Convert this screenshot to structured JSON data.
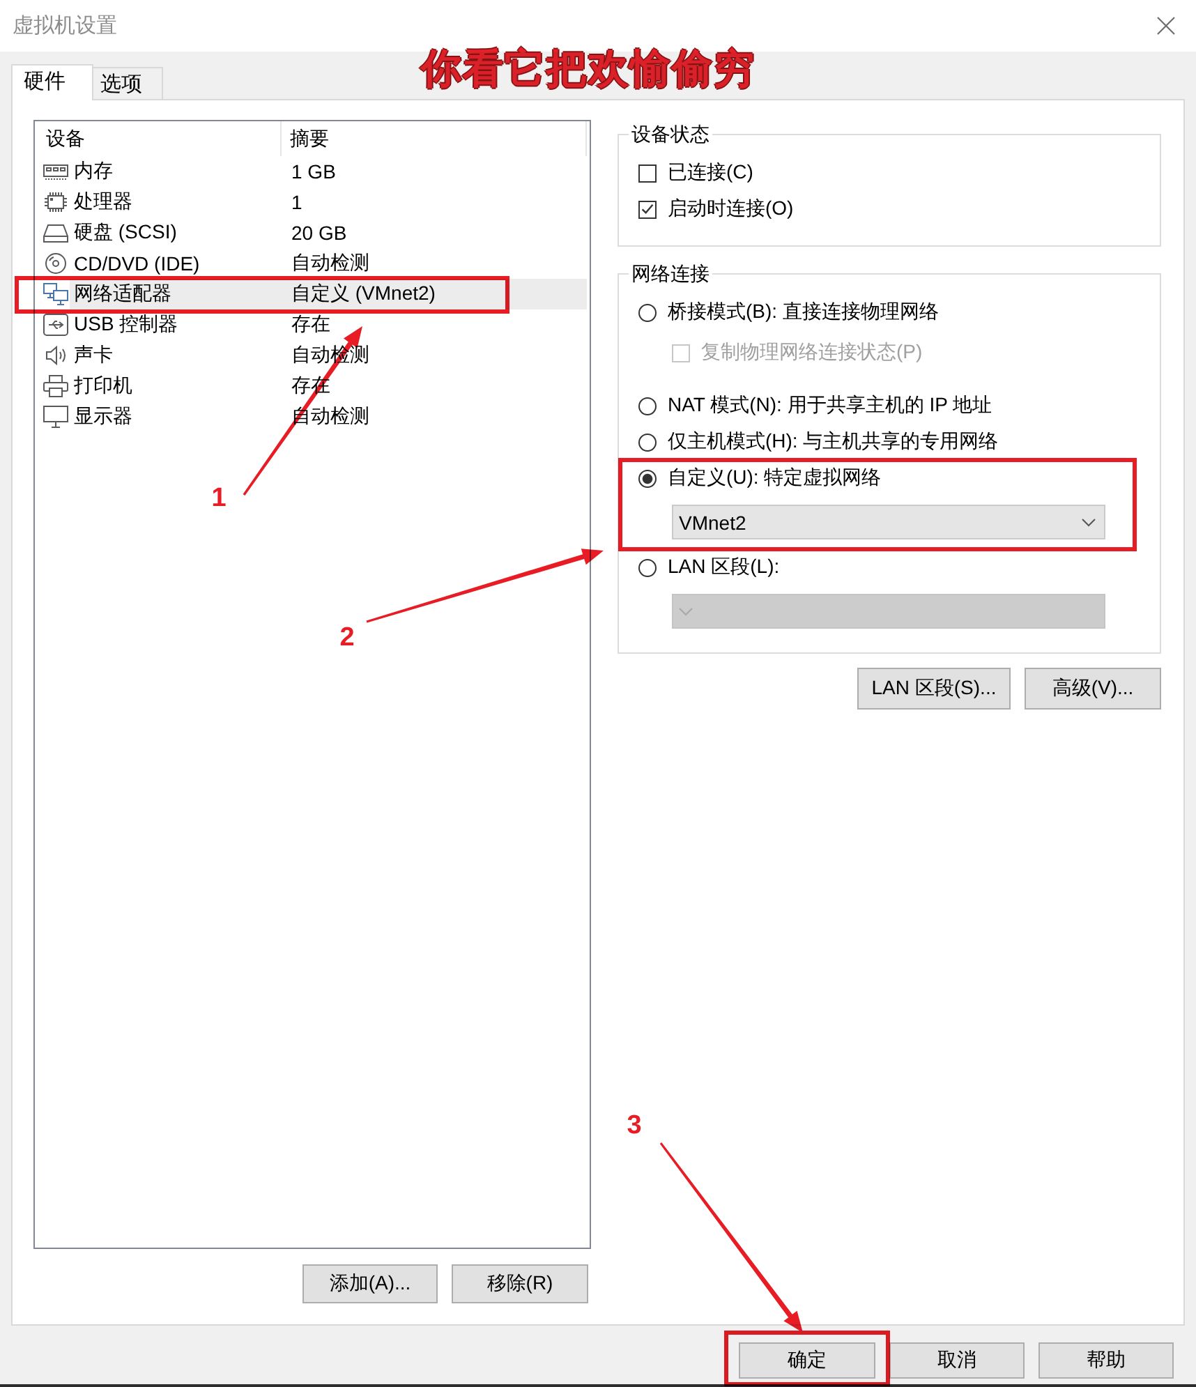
{
  "window": {
    "title": "虚拟机设置"
  },
  "tabs": [
    {
      "label": "硬件",
      "selected": true
    },
    {
      "label": "选项",
      "selected": false
    }
  ],
  "device_list": {
    "columns": [
      "设备",
      "摘要"
    ],
    "rows": [
      {
        "kind": "memory",
        "device": "内存",
        "summary": "1 GB",
        "selected": false
      },
      {
        "kind": "processor",
        "device": "处理器",
        "summary": "1",
        "selected": false
      },
      {
        "kind": "hard_disk",
        "device": "硬盘 (SCSI)",
        "summary": "20 GB",
        "selected": false
      },
      {
        "kind": "cd_dvd",
        "device": "CD/DVD (IDE)",
        "summary": "自动检测",
        "selected": false
      },
      {
        "kind": "network",
        "device": "网络适配器",
        "summary": "自定义 (VMnet2)",
        "selected": true
      },
      {
        "kind": "usb",
        "device": "USB 控制器",
        "summary": "存在",
        "selected": false
      },
      {
        "kind": "sound",
        "device": "声卡",
        "summary": "自动检测",
        "selected": false
      },
      {
        "kind": "printer",
        "device": "打印机",
        "summary": "存在",
        "selected": false
      },
      {
        "kind": "display",
        "device": "显示器",
        "summary": "自动检测",
        "selected": false
      }
    ]
  },
  "device_buttons": [
    "添加(A)...",
    "移除(R)"
  ],
  "device_status": {
    "title": "设备状态",
    "options": [
      {
        "kind": "checkbox",
        "label": "已连接(C)",
        "checked": false
      },
      {
        "kind": "checkbox",
        "label": "启动时连接(O)",
        "checked": true
      }
    ]
  },
  "network_connection": {
    "title": "网络连接",
    "options": [
      {
        "kind": "radio",
        "label": "桥接模式(B): 直接连接物理网络",
        "selected": false,
        "children": [
          {
            "kind": "checkbox",
            "label": "复制物理网络连接状态(P)",
            "checked": false,
            "disabled": true
          }
        ]
      },
      {
        "kind": "radio",
        "label": "NAT 模式(N): 用于共享主机的 IP 地址",
        "selected": false
      },
      {
        "kind": "radio",
        "label": "仅主机模式(H): 与主机共享的专用网络",
        "selected": false
      },
      {
        "kind": "radio",
        "label": "自定义(U): 特定虚拟网络",
        "selected": true,
        "children": [
          {
            "kind": "dropdown",
            "value": "VMnet2",
            "disabled": false
          }
        ]
      },
      {
        "kind": "radio",
        "label": "LAN 区段(L):",
        "selected": false,
        "children": [
          {
            "kind": "dropdown",
            "disabled": true
          }
        ]
      }
    ]
  },
  "network_buttons": [
    "LAN 区段(S)...",
    "高级(V)..."
  ],
  "dialog_buttons": [
    "确定",
    "取消",
    "帮助"
  ],
  "annotations": {
    "caption": "你看它把欢愉偷穷",
    "callouts": [
      {
        "number": "1"
      },
      {
        "number": "2"
      },
      {
        "number": "3"
      }
    ]
  }
}
